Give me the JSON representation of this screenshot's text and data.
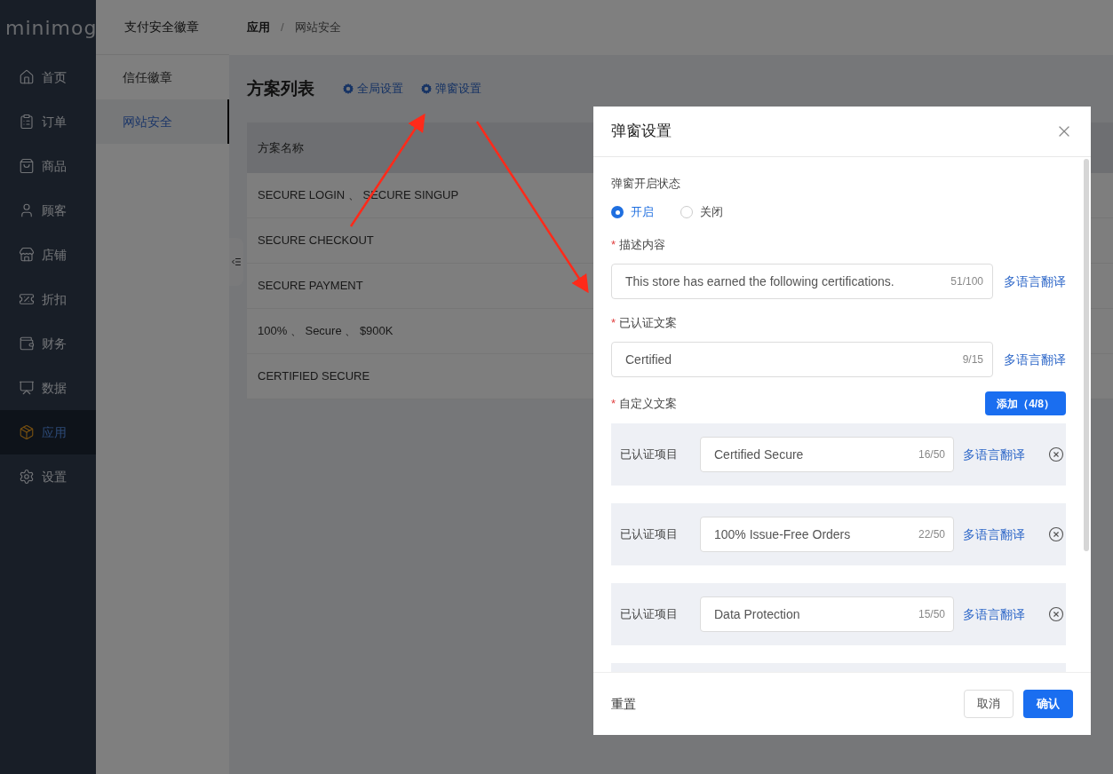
{
  "sidebar": {
    "logo": "minimog",
    "items": [
      {
        "label": "首页",
        "selected": false
      },
      {
        "label": "订单",
        "selected": false
      },
      {
        "label": "商品",
        "selected": false
      },
      {
        "label": "顾客",
        "selected": false
      },
      {
        "label": "店铺",
        "selected": false
      },
      {
        "label": "折扣",
        "selected": false
      },
      {
        "label": "财务",
        "selected": false
      },
      {
        "label": "数据",
        "selected": false
      },
      {
        "label": "应用",
        "selected": true
      },
      {
        "label": "设置",
        "selected": false
      }
    ]
  },
  "subnav": {
    "title": "支付安全徽章",
    "items": [
      {
        "label": "信任徽章",
        "selected": false
      },
      {
        "label": "网站安全",
        "selected": true
      }
    ]
  },
  "breadcrumb": {
    "items": [
      "应用",
      "网站安全"
    ],
    "separator": "/"
  },
  "page": {
    "title": "方案列表",
    "actions": [
      "全局设置",
      "弹窗设置"
    ]
  },
  "table": {
    "columns": [
      "方案名称"
    ],
    "rows": [
      [
        "SECURE LOGIN 、 SECURE SINGUP"
      ],
      [
        "SECURE CHECKOUT"
      ],
      [
        "SECURE PAYMENT"
      ],
      [
        "100% 、 Secure 、 $900K"
      ],
      [
        "CERTIFIED SECURE"
      ]
    ]
  },
  "dialog": {
    "title": "弹窗设置",
    "status": {
      "label": "弹窗开启状态",
      "options": [
        {
          "label": "开启",
          "selected": true
        },
        {
          "label": "关闭",
          "selected": false
        }
      ]
    },
    "fields": [
      {
        "mark": "*",
        "label": "描述内容",
        "value": "This store has earned the following certifications.",
        "counter": "51/100",
        "link": "多语言翻译"
      },
      {
        "mark": "*",
        "label": "已认证文案",
        "value": "Certified",
        "counter": "9/15",
        "link": "多语言翻译"
      }
    ],
    "custom": {
      "mark": "*",
      "label": "自定义文案",
      "add_button": "添加（4/8）",
      "items": [
        {
          "label": "已认证项目",
          "value": "Certified Secure",
          "counter": "16/50",
          "link": "多语言翻译"
        },
        {
          "label": "已认证项目",
          "value": "100% Issue-Free Orders",
          "counter": "22/50",
          "link": "多语言翻译"
        },
        {
          "label": "已认证项目",
          "value": "Data Protection",
          "counter": "15/50",
          "link": "多语言翻译"
        }
      ]
    },
    "reset": "重置",
    "cancel": "取消",
    "confirm": "确认"
  }
}
